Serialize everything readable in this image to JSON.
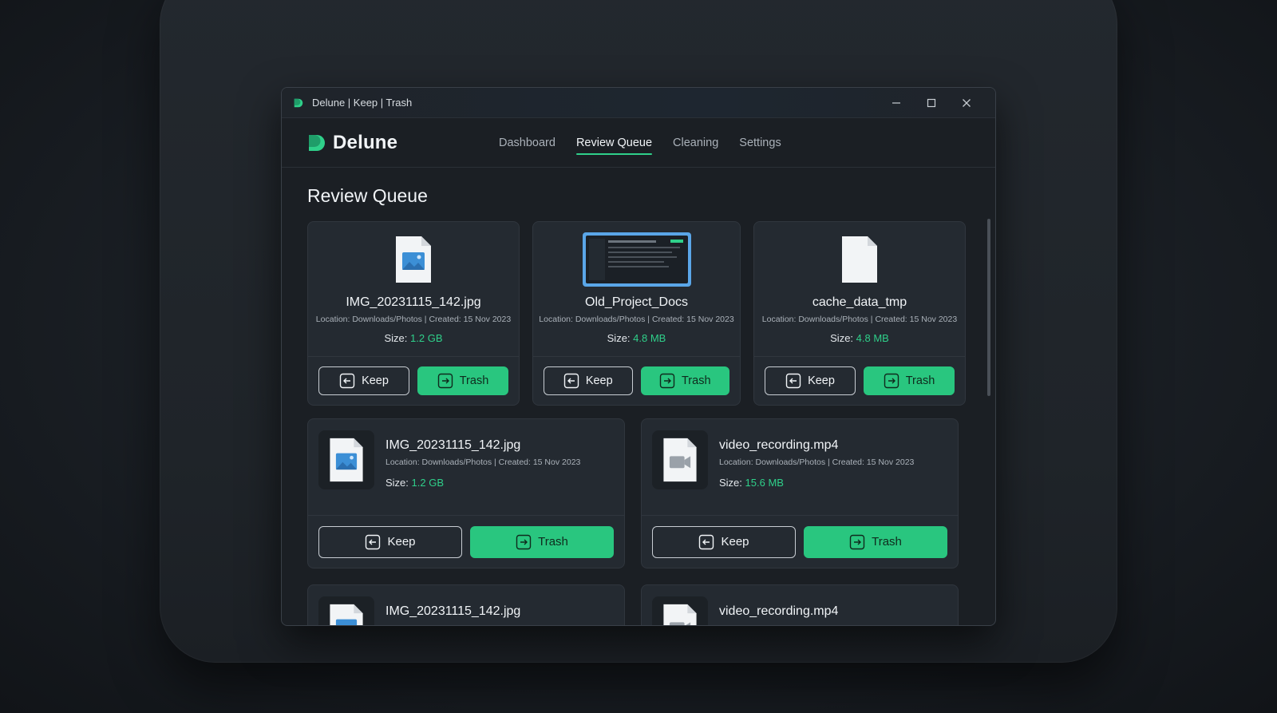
{
  "window": {
    "title": "Delune | Keep | Trash"
  },
  "brand": {
    "name": "Delune",
    "accent": "#2fd08a"
  },
  "nav": {
    "items": [
      "Dashboard",
      "Review Queue",
      "Cleaning",
      "Settings"
    ],
    "active": "Review Queue"
  },
  "page": {
    "title": "Review Queue"
  },
  "labels": {
    "size_prefix": "Size:",
    "keep": "Keep",
    "trash": "Trash"
  },
  "row1": [
    {
      "name": "IMG_20231115_142.jpg",
      "meta": "Location: Downloads/Photos | Created: 15 Nov 2023",
      "size": "1.2 GB",
      "icon": "image-file-icon"
    },
    {
      "name": "Old_Project_Docs",
      "meta": "Location: Downloads/Photos | Created: 15 Nov 2023",
      "size": "4.8 MB",
      "icon": "screenshot-thumbnail"
    },
    {
      "name": "cache_data_tmp",
      "meta": "Location: Downloads/Photos | Created: 15 Nov 2023",
      "size": "4.8 MB",
      "icon": "blank-file-icon"
    }
  ],
  "row2": [
    {
      "name": "IMG_20231115_142.jpg",
      "meta": "Location: Downloads/Photos | Created: 15 Nov 2023",
      "size": "1.2 GB",
      "icon": "image-file-icon"
    },
    {
      "name": "video_recording.mp4",
      "meta": "Location: Downloads/Photos | Created: 15 Nov 2023",
      "size": "15.6 MB",
      "icon": "video-file-icon"
    }
  ],
  "row3": [
    {
      "name": "IMG_20231115_142.jpg",
      "icon": "image-file-icon"
    },
    {
      "name": "video_recording.mp4",
      "icon": "video-file-icon"
    }
  ]
}
